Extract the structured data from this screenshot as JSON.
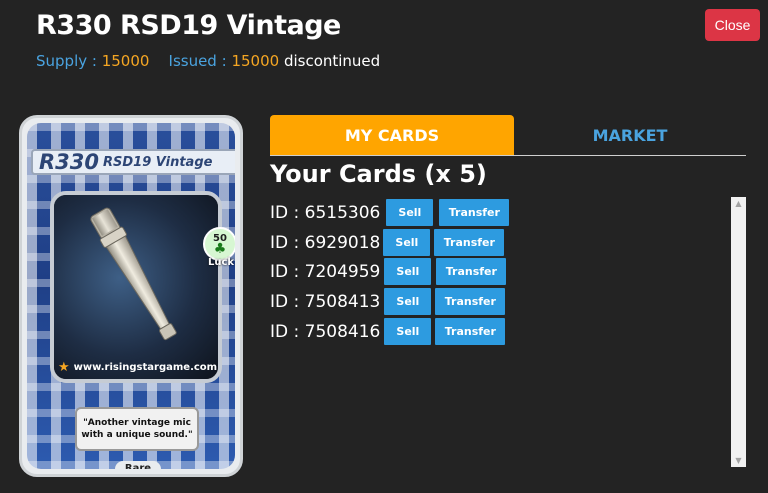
{
  "header": {
    "title": "R330 RSD19 Vintage",
    "supply_label": "Supply :",
    "supply_value": "15000",
    "issued_label": "Issued :",
    "issued_value": "15000",
    "status": "discontinued",
    "close_label": "Close"
  },
  "card": {
    "name_big": "R330",
    "name_small": "RSD19 Vintage",
    "stat_value": "50",
    "stat_name": "Luck",
    "site": "www.risingstargame.com",
    "quote": "\"Another vintage mic with a unique sound.\"",
    "rarity": "Rare",
    "icon": "microphone-icon"
  },
  "tabs": [
    {
      "label": "MY CARDS",
      "active": true
    },
    {
      "label": "MARKET",
      "active": false
    }
  ],
  "your_cards_heading": "Your Cards (x 5)",
  "cards": [
    {
      "id": "ID : 6515306",
      "sell": "Sell",
      "transfer": "Transfer"
    },
    {
      "id": "ID : 6929018",
      "sell": "Sell",
      "transfer": "Transfer"
    },
    {
      "id": "ID : 7204959",
      "sell": "Sell",
      "transfer": "Transfer"
    },
    {
      "id": "ID : 7508413",
      "sell": "Sell",
      "transfer": "Transfer"
    },
    {
      "id": "ID : 7508416",
      "sell": "Sell",
      "transfer": "Transfer"
    }
  ],
  "colors": {
    "accent_orange": "#ffa500",
    "button_blue": "#2d9be0",
    "close_red": "#dc3545",
    "label_blue": "#4aa3df",
    "value_orange": "#f5a623"
  }
}
